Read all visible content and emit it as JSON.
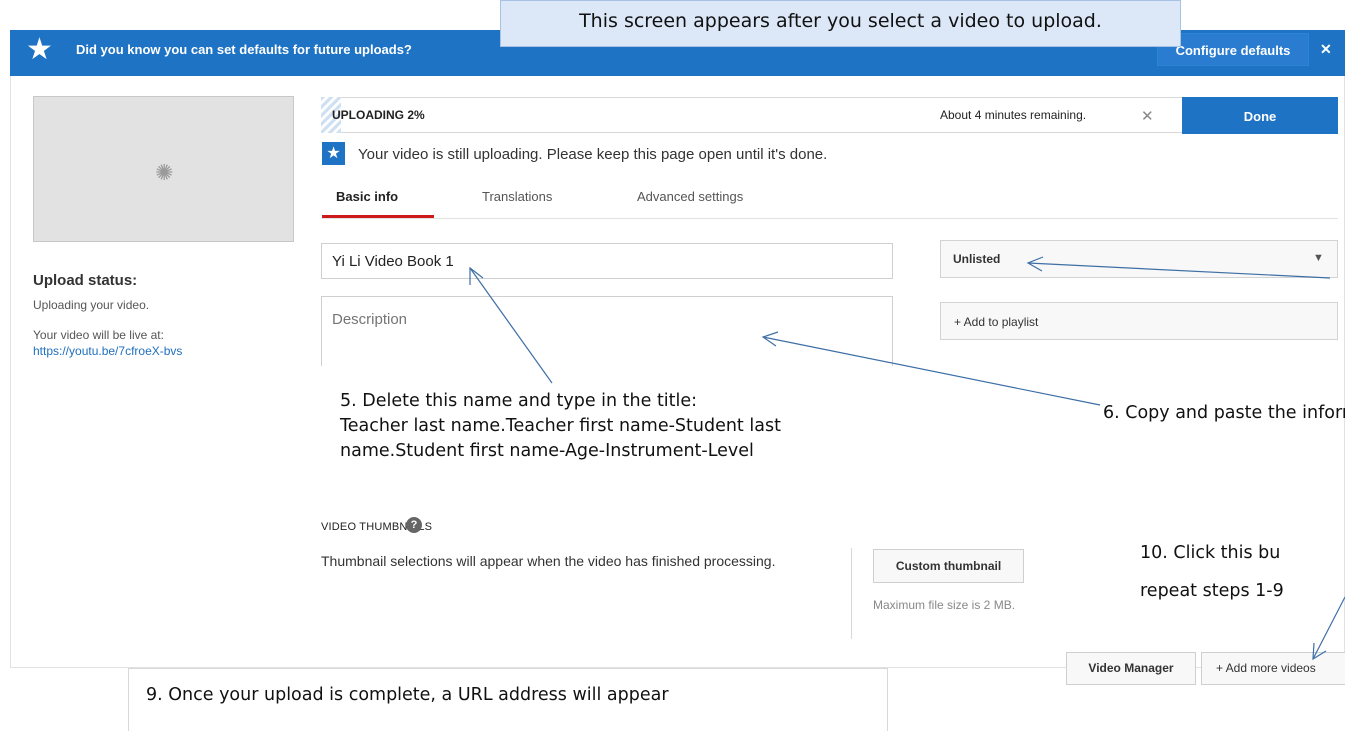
{
  "callout": "This screen appears after you select a video to upload.",
  "banner": {
    "text": "Did you know you can set defaults for future uploads?",
    "configure_label": "Configure defaults",
    "close_glyph": "✕"
  },
  "left": {
    "status_heading": "Upload status:",
    "status_line": "Uploading your video.",
    "live_line": "Your video will be live at:",
    "url": "https://youtu.be/7cfroeX-bvs"
  },
  "progress": {
    "label": "UPLOADING 2%",
    "percent": 2,
    "remaining": "About 4 minutes remaining.",
    "cancel_glyph": "✕"
  },
  "done_label": "Done",
  "info_text": "Your video is still uploading. Please keep this page open until it's done.",
  "tabs": [
    {
      "label": "Basic info",
      "active": true
    },
    {
      "label": "Translations",
      "active": false
    },
    {
      "label": "Advanced settings",
      "active": false
    }
  ],
  "fields": {
    "title_value": "Yi Li Video Book 1",
    "description_placeholder": "Description",
    "privacy_value": "Unlisted",
    "playlist_label": "+ Add to playlist"
  },
  "notes": {
    "n5_line1": "5.  Delete this name and type in the title:",
    "n5_line2": "Teacher last name.Teacher first name-Student last",
    "n5_line3": "name.Student first name-Age-Instrument-Level",
    "n6": "6.  Copy and paste the inform",
    "n10_line1": "10.  Click this bu",
    "n10_line2": "repeat steps 1-9",
    "n9_line1": "9.  Once your upload is complete, a URL address will appear"
  },
  "thumbnails": {
    "heading": "VIDEO THUMBNAILS",
    "help_glyph": "?",
    "text": "Thumbnail selections will appear when the video has finished processing.",
    "custom_label": "Custom thumbnail",
    "max_size": "Maximum file size is 2 MB."
  },
  "bottom": {
    "video_manager_label": "Video Manager",
    "add_more_label": "+  Add more videos"
  },
  "colors": {
    "brand_blue": "#1f73c4",
    "tab_underline": "#cc1a1a",
    "link": "#1f6fbf",
    "arrow": "#3d6fa5"
  }
}
